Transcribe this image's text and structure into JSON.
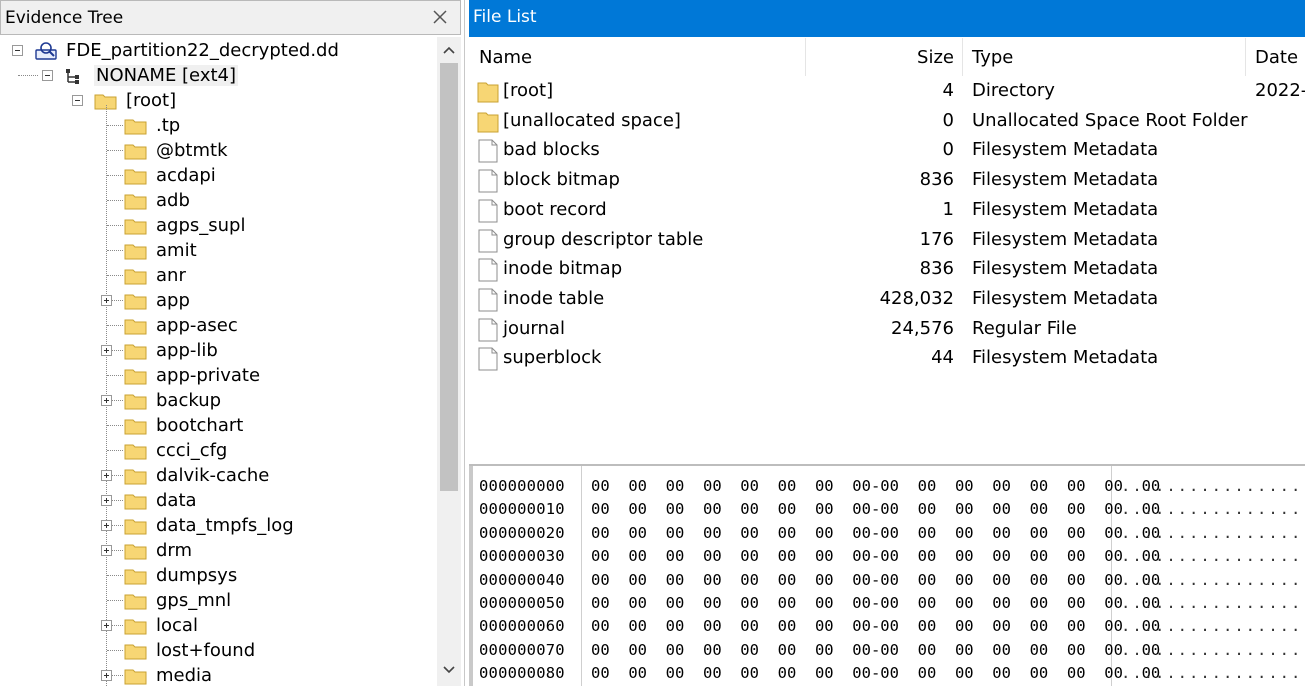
{
  "evidence_tree": {
    "title": "Evidence Tree",
    "root_label": "FDE_partition22_decrypted.dd",
    "volume_label": "NONAME [ext4]",
    "folder_label": "[root]",
    "items": [
      {
        "label": ".tp",
        "expandable": false
      },
      {
        "label": "@btmtk",
        "expandable": false
      },
      {
        "label": "acdapi",
        "expandable": false
      },
      {
        "label": "adb",
        "expandable": false
      },
      {
        "label": "agps_supl",
        "expandable": false
      },
      {
        "label": "amit",
        "expandable": false
      },
      {
        "label": "anr",
        "expandable": false
      },
      {
        "label": "app",
        "expandable": true
      },
      {
        "label": "app-asec",
        "expandable": false
      },
      {
        "label": "app-lib",
        "expandable": true
      },
      {
        "label": "app-private",
        "expandable": false
      },
      {
        "label": "backup",
        "expandable": true
      },
      {
        "label": "bootchart",
        "expandable": false
      },
      {
        "label": "ccci_cfg",
        "expandable": false
      },
      {
        "label": "dalvik-cache",
        "expandable": true
      },
      {
        "label": "data",
        "expandable": true
      },
      {
        "label": "data_tmpfs_log",
        "expandable": true
      },
      {
        "label": "drm",
        "expandable": true
      },
      {
        "label": "dumpsys",
        "expandable": false
      },
      {
        "label": "gps_mnl",
        "expandable": false
      },
      {
        "label": "local",
        "expandable": true
      },
      {
        "label": "lost+found",
        "expandable": false
      },
      {
        "label": "media",
        "expandable": true
      }
    ]
  },
  "file_list": {
    "title": "File List",
    "columns": {
      "name": "Name",
      "size": "Size",
      "type": "Type",
      "date": "Date M"
    },
    "rows": [
      {
        "name": "[root]",
        "size": "4",
        "type": "Directory",
        "date": "2022-",
        "icon": "folder-icon"
      },
      {
        "name": "[unallocated space]",
        "size": "0",
        "type": "Unallocated Space Root Folder",
        "date": "",
        "icon": "folder-icon"
      },
      {
        "name": "bad blocks",
        "size": "0",
        "type": "Filesystem Metadata",
        "date": "",
        "icon": "file-icon"
      },
      {
        "name": "block bitmap",
        "size": "836",
        "type": "Filesystem Metadata",
        "date": "",
        "icon": "file-icon"
      },
      {
        "name": "boot record",
        "size": "1",
        "type": "Filesystem Metadata",
        "date": "",
        "icon": "file-icon"
      },
      {
        "name": "group descriptor table",
        "size": "176",
        "type": "Filesystem Metadata",
        "date": "",
        "icon": "file-icon"
      },
      {
        "name": "inode bitmap",
        "size": "836",
        "type": "Filesystem Metadata",
        "date": "",
        "icon": "file-icon"
      },
      {
        "name": "inode table",
        "size": "428,032",
        "type": "Filesystem Metadata",
        "date": "",
        "icon": "file-icon"
      },
      {
        "name": "journal",
        "size": "24,576",
        "type": "Regular File",
        "date": "",
        "icon": "file-icon"
      },
      {
        "name": "superblock",
        "size": "44",
        "type": "Filesystem Metadata",
        "date": "",
        "icon": "file-icon"
      }
    ]
  },
  "hex_view": {
    "rows": [
      {
        "offset": "000000000",
        "bytes": "00  00  00  00  00  00  00  00-00  00  00  00  00  00  00  00",
        "ascii": "................"
      },
      {
        "offset": "000000010",
        "bytes": "00  00  00  00  00  00  00  00-00  00  00  00  00  00  00  00",
        "ascii": "................"
      },
      {
        "offset": "000000020",
        "bytes": "00  00  00  00  00  00  00  00-00  00  00  00  00  00  00  00",
        "ascii": "................"
      },
      {
        "offset": "000000030",
        "bytes": "00  00  00  00  00  00  00  00-00  00  00  00  00  00  00  00",
        "ascii": "................"
      },
      {
        "offset": "000000040",
        "bytes": "00  00  00  00  00  00  00  00-00  00  00  00  00  00  00  00",
        "ascii": "................"
      },
      {
        "offset": "000000050",
        "bytes": "00  00  00  00  00  00  00  00-00  00  00  00  00  00  00  00",
        "ascii": "................"
      },
      {
        "offset": "000000060",
        "bytes": "00  00  00  00  00  00  00  00-00  00  00  00  00  00  00  00",
        "ascii": "................"
      },
      {
        "offset": "000000070",
        "bytes": "00  00  00  00  00  00  00  00-00  00  00  00  00  00  00  00",
        "ascii": "................"
      },
      {
        "offset": "000000080",
        "bytes": "00  00  00  00  00  00  00  00-00  00  00  00  00  00  00  00",
        "ascii": "................"
      }
    ]
  },
  "colors": {
    "accent": "#0078d7",
    "folder": "#f7d674",
    "folder_border": "#c9a232"
  }
}
